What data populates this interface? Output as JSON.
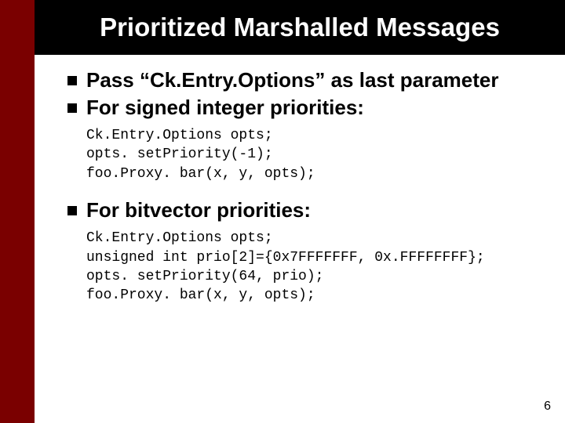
{
  "title": "Prioritized Marshalled Messages",
  "bullets": {
    "b1": "Pass “Ck.Entry.Options” as last parameter",
    "b2": "For signed integer priorities:",
    "b3": "For bitvector priorities:"
  },
  "code": {
    "c1": "Ck.Entry.Options opts;\nopts. setPriority(-1);\nfoo.Proxy. bar(x, y, opts);",
    "c2": "Ck.Entry.Options opts;\nunsigned int prio[2]={0x7FFFFFFF, 0x.FFFFFFFF};\nopts. setPriority(64, prio);\nfoo.Proxy. bar(x, y, opts);"
  },
  "page_number": "6"
}
